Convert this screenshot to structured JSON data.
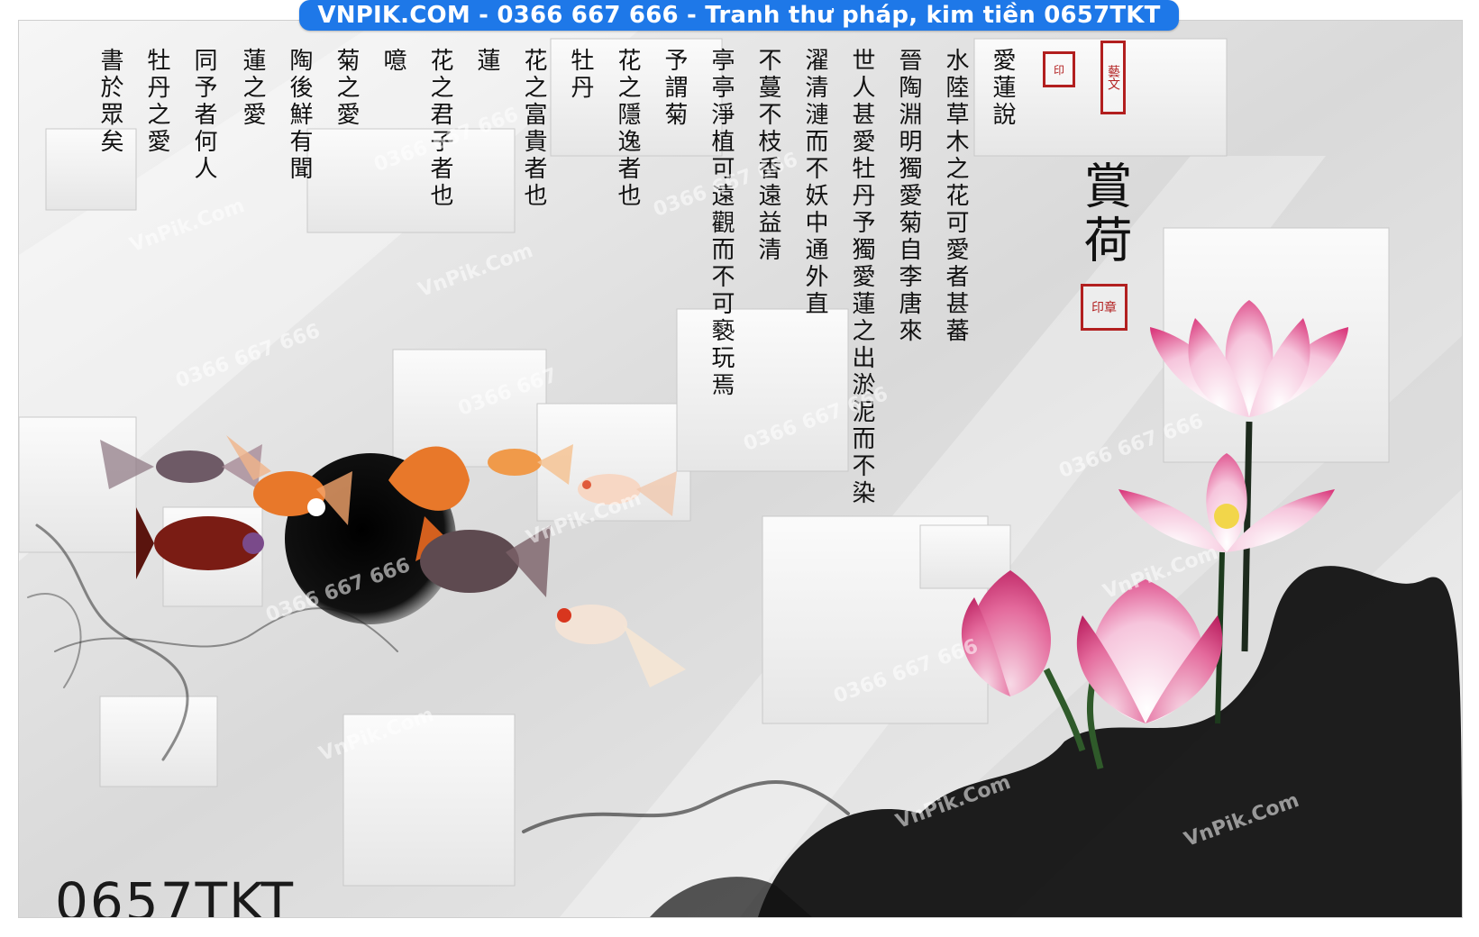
{
  "banner": {
    "text": "VNPIK.COM - 0366 667 666 - Tranh thư pháp, kim tiền 0657TKT",
    "color": "#1e78e8"
  },
  "product_code": "0657TKT",
  "watermarks": [
    "VnPik.Com",
    "0366 667 666",
    "VnPik.Com",
    "0366 667",
    "0366 667 666",
    "0366 667 666",
    "VnPik.Com",
    "0366 667 666",
    "VnPik.Com",
    "0366 667 666",
    "0366 667 666",
    "VnPik.Com",
    "0366 667 666",
    "VnPik.Com",
    "VnPik.Com"
  ],
  "colors": {
    "lotus_pink": "#e0508a",
    "goldfish_orange": "#e8782a",
    "ink": "#111111",
    "seal_red": "#b21f1f"
  },
  "artwork": {
    "icons": [
      "lotus-flower-icon",
      "goldfish-icon",
      "ink-smoke-icon",
      "calligraphy-icon",
      "red-seal-icon"
    ]
  }
}
